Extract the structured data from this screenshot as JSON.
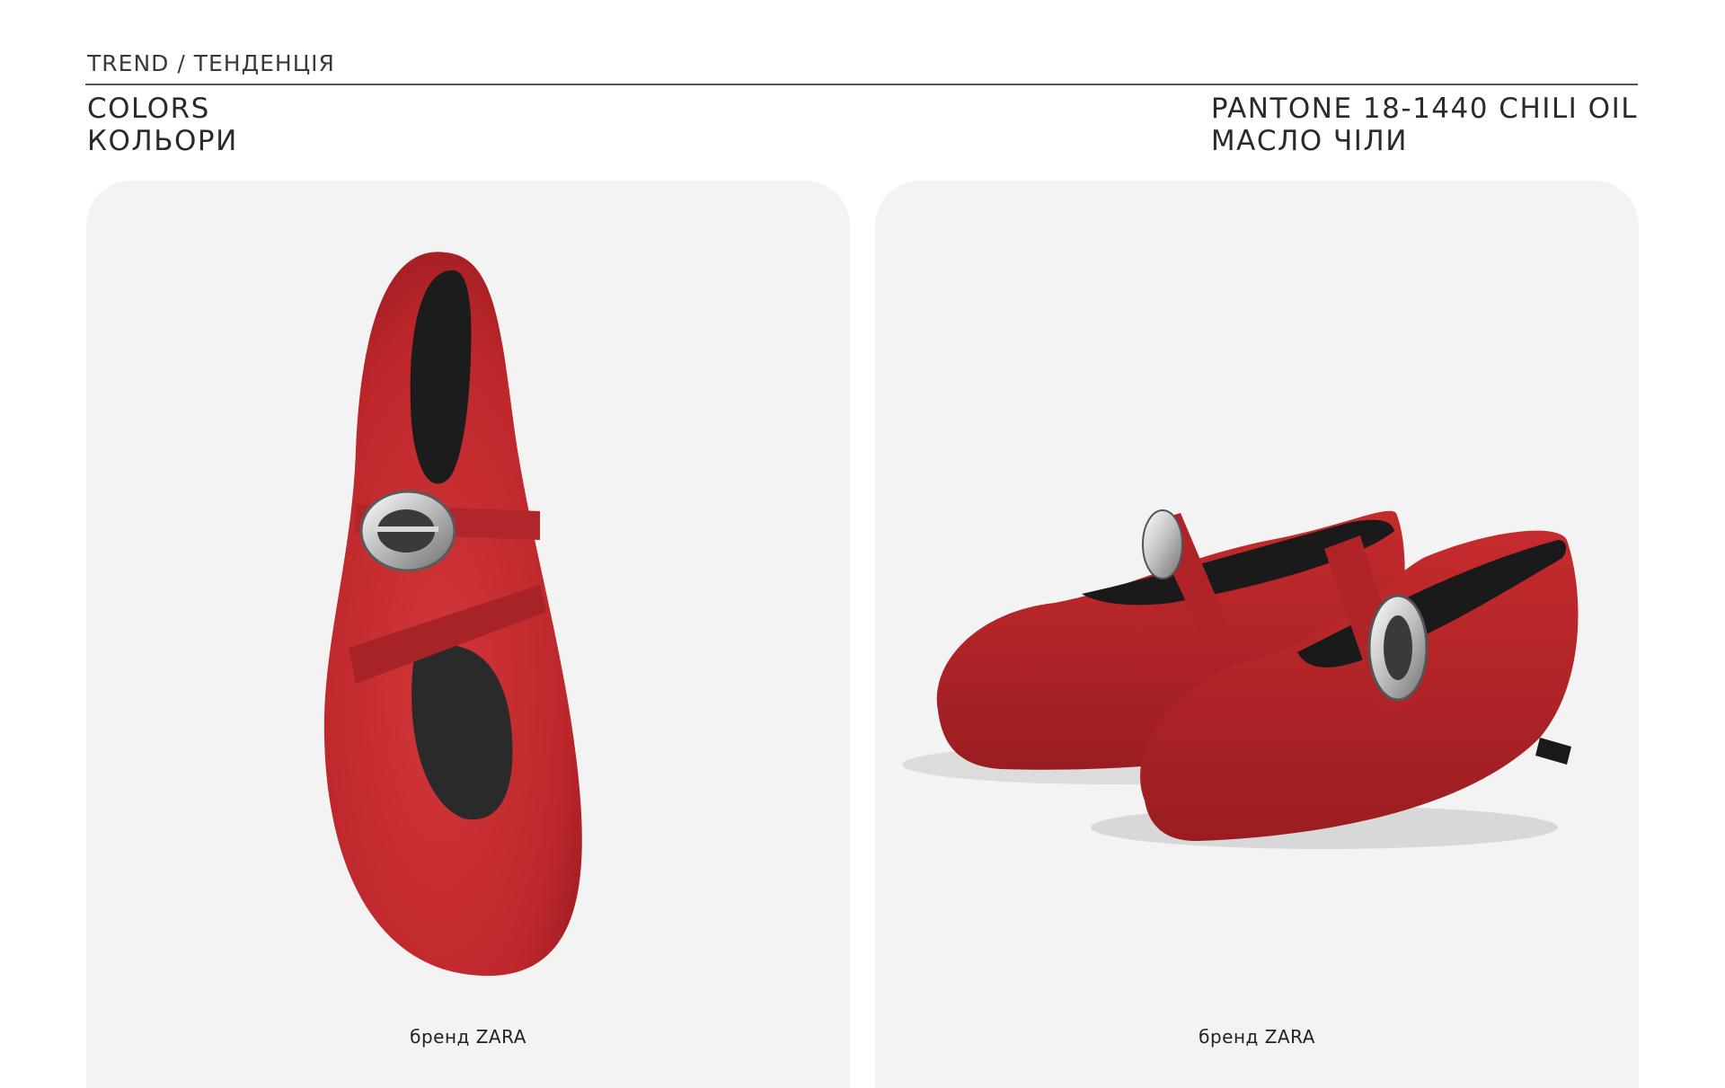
{
  "header": {
    "breadcrumb": "TREND / ТЕНДЕНЦІЯ",
    "section_title_en": "COLORS",
    "section_title_uk": "КОЛЬОРИ",
    "color_name_en": "PANTONE 18-1440 CHILI OIL",
    "color_name_uk": "МАСЛО ЧІЛИ"
  },
  "cards": [
    {
      "caption": "бренд ZARA"
    },
    {
      "caption": "бренд ZARA"
    }
  ],
  "colors": {
    "shoe_red": "#c62b2e",
    "shoe_dark": "#8e1a1f",
    "card_bg": "#f3f3f3",
    "buckle": "#d9d9d9"
  }
}
